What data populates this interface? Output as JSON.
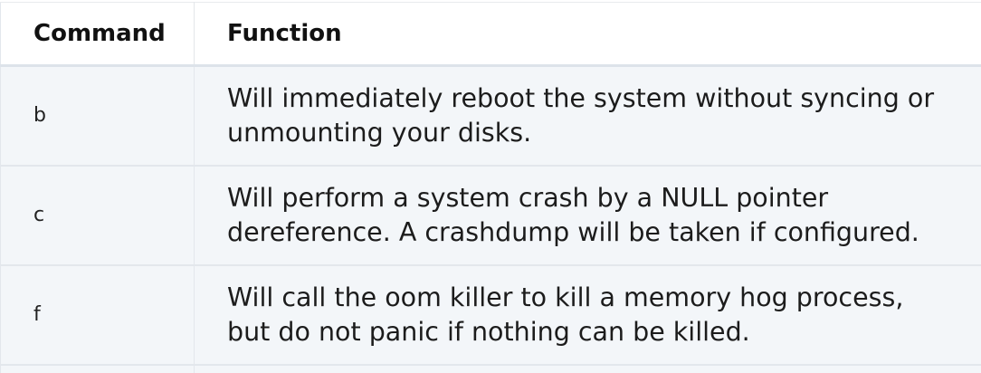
{
  "table": {
    "headers": {
      "command": "Command",
      "function": "Function"
    },
    "rows": [
      {
        "command": "b",
        "function": "Will immediately reboot the system without syncing or unmounting your disks."
      },
      {
        "command": "c",
        "function": "Will perform a system crash by a NULL pointer dereference. A crashdump will be taken if configured."
      },
      {
        "command": "f",
        "function": "Will call the oom killer to kill a memory hog process, but do not panic if nothing can be killed."
      }
    ]
  }
}
